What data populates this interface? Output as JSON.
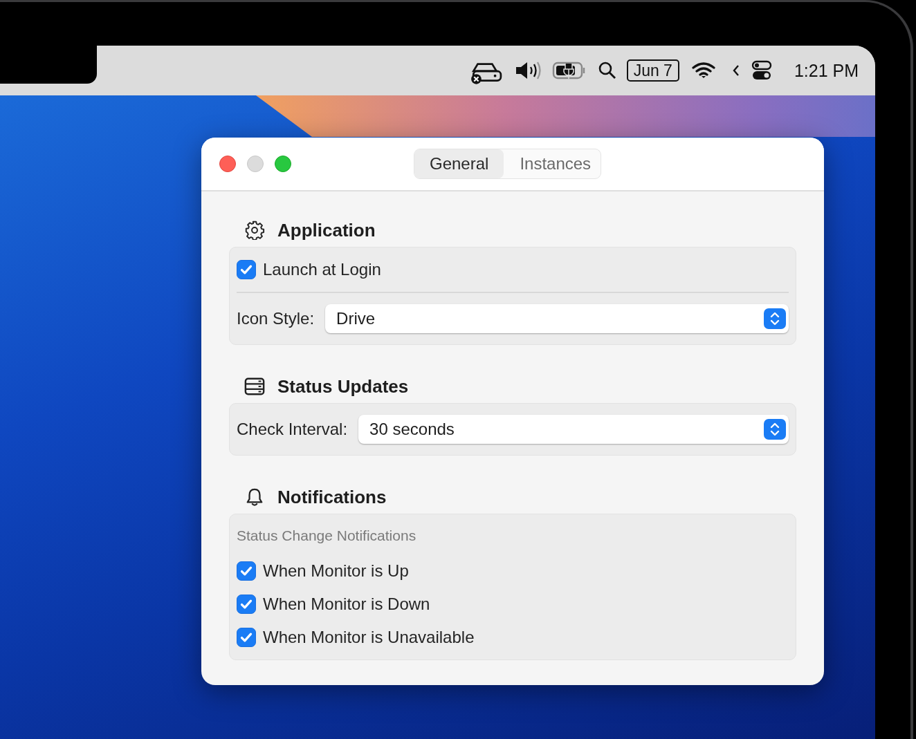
{
  "menu_bar": {
    "date": "Jun 7",
    "clock": "1:21 PM"
  },
  "window": {
    "tabs": [
      {
        "label": "General",
        "selected": true
      },
      {
        "label": "Instances",
        "selected": false
      }
    ],
    "sections": [
      {
        "title": "Application",
        "rows": [
          {
            "kind": "checkbox",
            "label": "Launch at Login",
            "checked": true
          },
          {
            "kind": "popup",
            "label": "Icon Style:",
            "value": "Drive"
          }
        ]
      },
      {
        "title": "Status Updates",
        "rows": [
          {
            "kind": "popup",
            "label": "Check Interval:",
            "value": "30 seconds"
          }
        ]
      },
      {
        "title": "Notifications",
        "rows": [
          {
            "kind": "caption",
            "label": "Status Change Notifications"
          },
          {
            "kind": "checkbox",
            "label": "When Monitor is Up",
            "checked": true
          },
          {
            "kind": "checkbox",
            "label": "When Monitor is Down",
            "checked": true
          },
          {
            "kind": "checkbox",
            "label": "When Monitor is Unavailable",
            "checked": true
          }
        ]
      }
    ]
  }
}
